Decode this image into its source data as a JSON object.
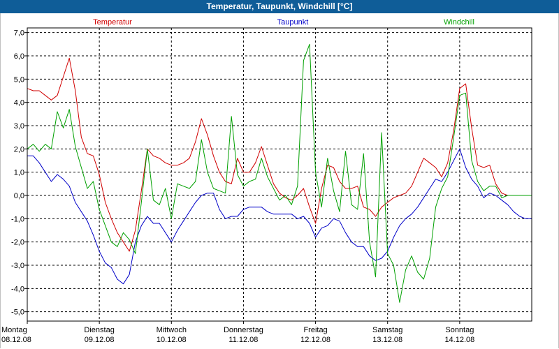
{
  "window": {
    "title": "Temperatur, Taupunkt, Windchill [°C]"
  },
  "chart_data": {
    "type": "line",
    "title": "Temperatur, Taupunkt, Windchill [°C]",
    "ylim": [
      -5.4,
      7.2
    ],
    "xlim": [
      0,
      168
    ],
    "grid": true,
    "legend_placement": "top",
    "y_ticks": [
      "7,0",
      "6,0",
      "5,0",
      "4,0",
      "3,0",
      "2,0",
      "1,0",
      "0,0",
      "-1,0",
      "-2,0",
      "-3,0",
      "-4,0",
      "-5,0"
    ],
    "y_tick_values": [
      7,
      6,
      5,
      4,
      3,
      2,
      1,
      0,
      -1,
      -2,
      -3,
      -4,
      -5
    ],
    "x_ticks": [
      {
        "day": "Montag",
        "date": "08.12.08"
      },
      {
        "day": "Dienstag",
        "date": "09.12.08"
      },
      {
        "day": "Mittwoch",
        "date": "10.12.08"
      },
      {
        "day": "Donnerstag",
        "date": "11.12.08"
      },
      {
        "day": "Freitag",
        "date": "12.12.08"
      },
      {
        "day": "Samstag",
        "date": "13.12.08"
      },
      {
        "day": "Sonntag",
        "date": "14.12.08"
      }
    ],
    "series": [
      {
        "name": "Temperatur",
        "color": "#d00000",
        "x": [
          0,
          2,
          4,
          6,
          8,
          10,
          12,
          14,
          16,
          18,
          20,
          22,
          24,
          26,
          28,
          30,
          32,
          34,
          36,
          38,
          40,
          42,
          44,
          46,
          48,
          50,
          52,
          54,
          56,
          58,
          60,
          62,
          64,
          66,
          68,
          70,
          72,
          74,
          76,
          78,
          80,
          82,
          84,
          86,
          88,
          90,
          92,
          94,
          96,
          98,
          100,
          102,
          104,
          106,
          108,
          110,
          112,
          114,
          116,
          118,
          120,
          122,
          124,
          126,
          128,
          130,
          132,
          134,
          136,
          138,
          140,
          142,
          144,
          146,
          148,
          150,
          152,
          154,
          156,
          158,
          160,
          162,
          164,
          166,
          168
        ],
        "values": [
          4.6,
          4.5,
          4.5,
          4.3,
          4.1,
          4.3,
          5.1,
          5.9,
          4.5,
          2.5,
          1.8,
          1.7,
          0.9,
          -0.3,
          -1.0,
          -1.6,
          -2.0,
          -2.4,
          -1.5,
          0.2,
          2.0,
          1.7,
          1.6,
          1.4,
          1.3,
          1.3,
          1.4,
          1.6,
          2.3,
          3.3,
          2.6,
          1.7,
          1.0,
          0.6,
          0.5,
          1.6,
          1.0,
          1.0,
          1.4,
          2.1,
          1.3,
          0.5,
          0.1,
          -0.1,
          -0.2,
          0.0,
          0.3,
          -0.5,
          -1.2,
          0.3,
          1.3,
          1.2,
          0.6,
          0.3,
          0.3,
          0.4,
          -0.5,
          -0.6,
          -0.9,
          -0.5,
          -0.3,
          -0.1,
          0.0,
          0.1,
          0.4,
          1.0,
          1.6,
          1.4,
          1.2,
          0.8,
          1.4,
          2.8,
          4.6,
          4.8,
          2.9,
          1.3,
          1.2,
          1.3,
          0.5,
          0.1,
          0.0,
          0.0,
          0.0,
          0.0,
          0.0
        ]
      },
      {
        "name": "Taupunkt",
        "color": "#0000c8",
        "x": [
          0,
          2,
          4,
          6,
          8,
          10,
          12,
          14,
          16,
          18,
          20,
          22,
          24,
          26,
          28,
          30,
          32,
          34,
          36,
          38,
          40,
          42,
          44,
          46,
          48,
          50,
          52,
          54,
          56,
          58,
          60,
          62,
          64,
          66,
          68,
          70,
          72,
          74,
          76,
          78,
          80,
          82,
          84,
          86,
          88,
          90,
          92,
          94,
          96,
          98,
          100,
          102,
          104,
          106,
          108,
          110,
          112,
          114,
          116,
          118,
          120,
          122,
          124,
          126,
          128,
          130,
          132,
          134,
          136,
          138,
          140,
          142,
          144,
          146,
          148,
          150,
          152,
          154,
          156,
          158,
          160,
          162,
          164,
          166,
          168
        ],
        "values": [
          1.7,
          1.7,
          1.4,
          1.0,
          0.6,
          0.9,
          0.7,
          0.4,
          -0.3,
          -0.7,
          -1.1,
          -1.7,
          -2.4,
          -2.9,
          -3.1,
          -3.6,
          -3.8,
          -3.4,
          -2.0,
          -1.3,
          -0.9,
          -1.2,
          -1.2,
          -1.6,
          -2.0,
          -1.5,
          -1.1,
          -0.7,
          -0.3,
          0.0,
          0.1,
          0.1,
          -0.6,
          -1.0,
          -0.9,
          -0.9,
          -0.6,
          -0.5,
          -0.5,
          -0.5,
          -0.7,
          -0.8,
          -0.8,
          -0.8,
          -0.8,
          -1.0,
          -0.9,
          -1.2,
          -1.8,
          -1.4,
          -1.3,
          -1.0,
          -1.1,
          -1.6,
          -2.0,
          -2.2,
          -2.2,
          -2.6,
          -2.8,
          -2.7,
          -2.4,
          -1.8,
          -1.3,
          -1.0,
          -0.8,
          -0.5,
          -0.1,
          0.3,
          0.7,
          0.6,
          1.0,
          1.5,
          2.0,
          1.2,
          0.7,
          0.4,
          -0.1,
          0.1,
          0.0,
          -0.2,
          -0.4,
          -0.7,
          -0.9,
          -1.0,
          -1.0
        ]
      },
      {
        "name": "Windchill",
        "color": "#00a000",
        "x": [
          0,
          2,
          4,
          6,
          8,
          10,
          12,
          14,
          16,
          18,
          20,
          22,
          24,
          26,
          28,
          30,
          32,
          34,
          36,
          38,
          40,
          42,
          44,
          46,
          48,
          50,
          52,
          54,
          56,
          58,
          60,
          62,
          64,
          66,
          68,
          70,
          72,
          74,
          76,
          78,
          80,
          82,
          84,
          86,
          88,
          90,
          92,
          94,
          96,
          98,
          100,
          102,
          104,
          106,
          108,
          110,
          112,
          114,
          116,
          118,
          120,
          122,
          124,
          126,
          128,
          130,
          132,
          134,
          136,
          138,
          140,
          142,
          144,
          146,
          148,
          150,
          152,
          154,
          156,
          158,
          160,
          162,
          164,
          166,
          168
        ],
        "values": [
          2.0,
          2.2,
          1.9,
          2.2,
          2.0,
          3.6,
          2.9,
          3.7,
          2.1,
          1.2,
          0.3,
          0.6,
          -0.6,
          -1.3,
          -2.0,
          -2.2,
          -1.6,
          -1.9,
          -2.5,
          -0.3,
          2.0,
          -0.2,
          -0.4,
          0.3,
          -1.0,
          0.5,
          0.4,
          0.3,
          0.6,
          2.4,
          1.0,
          0.3,
          0.2,
          0.1,
          3.4,
          0.9,
          0.4,
          0.6,
          0.7,
          1.6,
          0.8,
          0.3,
          -0.2,
          0.0,
          -0.4,
          0.4,
          5.8,
          6.5,
          1.0,
          -0.5,
          1.6,
          0.2,
          -0.7,
          1.9,
          -0.4,
          -0.6,
          1.8,
          -2.0,
          -3.5,
          2.7,
          -2.5,
          -3.0,
          -4.6,
          -3.2,
          -2.6,
          -3.3,
          -3.6,
          -2.7,
          -0.5,
          0.3,
          0.8,
          2.5,
          4.3,
          4.4,
          1.5,
          0.6,
          0.2,
          0.4,
          0.4,
          -0.1,
          0.0,
          0.0,
          0.0,
          0.0,
          0.0
        ]
      }
    ]
  }
}
